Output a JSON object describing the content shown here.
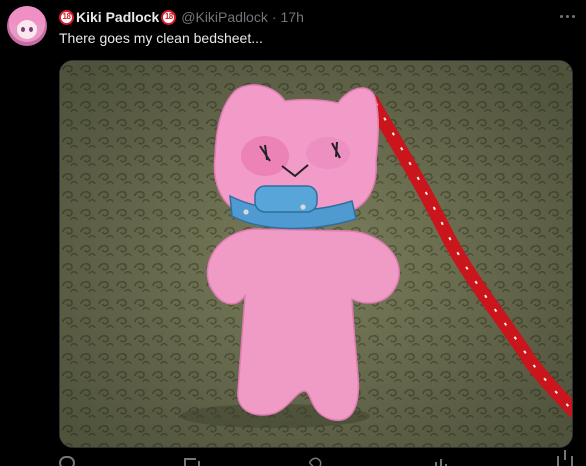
{
  "post": {
    "author": {
      "badge_left": "18",
      "display_name": "Kiki Padlock",
      "badge_right": "18",
      "handle": "@KikiPadlock",
      "separator": "·",
      "timestamp": "17h"
    },
    "text": "There goes my clean bedsheet...",
    "actions": {
      "reply_count": "",
      "repost_count": "",
      "like_count": "",
      "view_count": ""
    }
  },
  "icons": [
    "avatar",
    "more-icon",
    "reply-icon",
    "repost-icon",
    "like-icon",
    "views-icon",
    "share-icon"
  ],
  "colors": {
    "background": "#000000",
    "text_primary": "#e7e9ea",
    "text_secondary": "#71767b",
    "badge_red": "#d41c2d",
    "border": "#2f3336"
  }
}
